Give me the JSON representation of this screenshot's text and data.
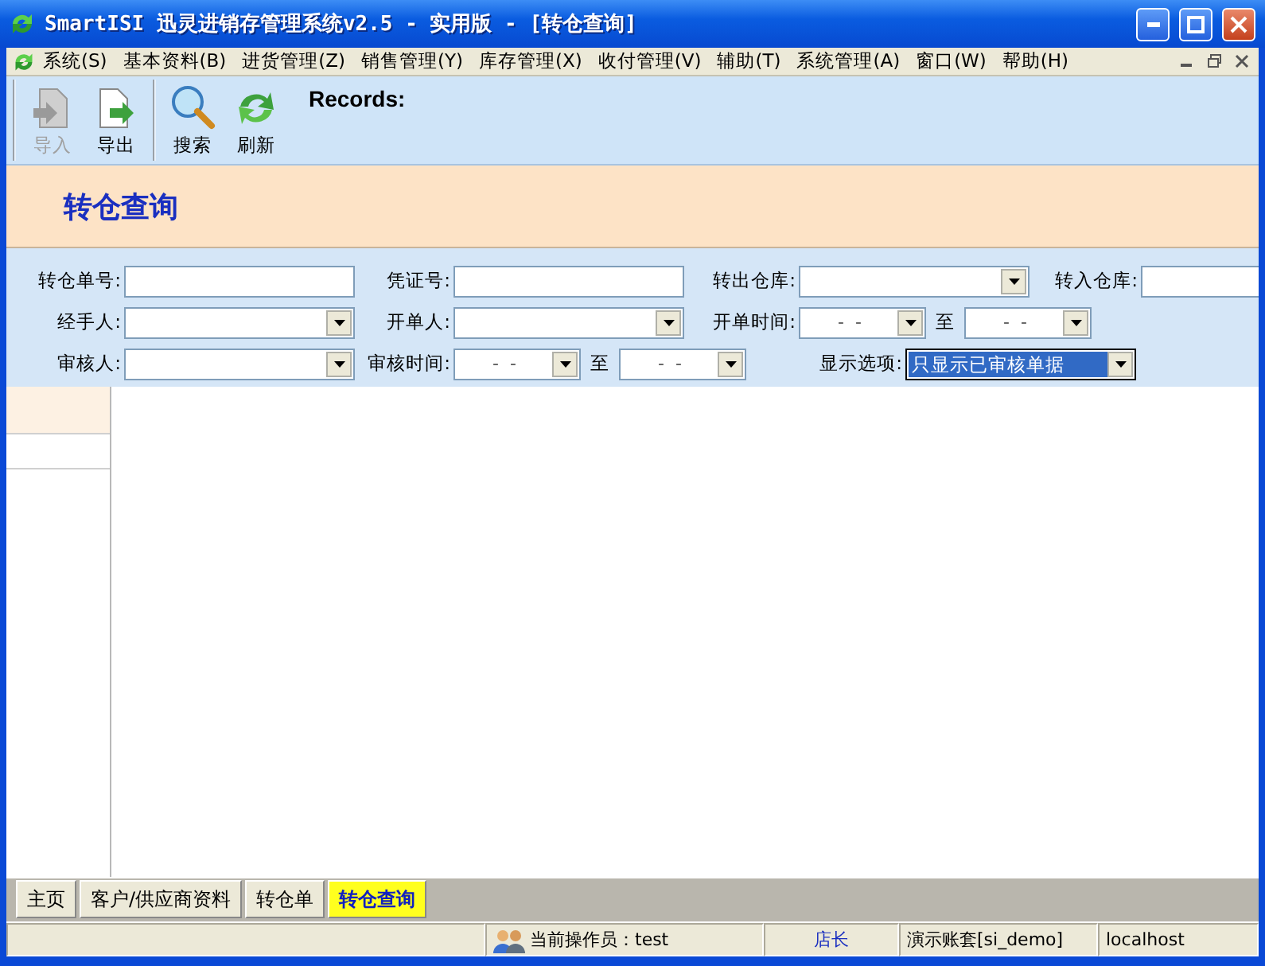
{
  "window": {
    "title": "SmartISI 迅灵进销存管理系统v2.5 - 实用版 - [转仓查询]"
  },
  "menu": [
    "系统(S)",
    "基本资料(B)",
    "进货管理(Z)",
    "销售管理(Y)",
    "库存管理(X)",
    "收付管理(V)",
    "辅助(T)",
    "系统管理(A)",
    "窗口(W)",
    "帮助(H)"
  ],
  "toolbar": {
    "groups": [
      [
        {
          "kind": "import",
          "label": "导入",
          "disabled": true
        },
        {
          "kind": "export",
          "label": "导出",
          "disabled": false
        }
      ],
      [
        {
          "kind": "search",
          "label": "搜索",
          "disabled": false
        },
        {
          "kind": "refresh",
          "label": "刷新",
          "disabled": false
        }
      ]
    ],
    "records_label": "Records:"
  },
  "page_title": "转仓查询",
  "filters": [
    [
      {
        "kind": "text",
        "label": "转仓单号:"
      },
      {
        "kind": "text",
        "label": "凭证号:"
      },
      {
        "kind": "combo",
        "label": "转出仓库:"
      },
      {
        "kind": "text",
        "label": "转入仓库:"
      }
    ],
    [
      {
        "kind": "combo",
        "label": "经手人:"
      },
      {
        "kind": "combo",
        "label": "开单人:"
      },
      {
        "kind": "range",
        "label": "开单时间:",
        "from": "-  -",
        "sep": "至",
        "to": "-  -"
      }
    ],
    [
      {
        "kind": "combo",
        "label": "审核人:"
      },
      {
        "kind": "range",
        "label": "审核时间:",
        "from": "-  -",
        "sep": "至",
        "to": "-  -"
      },
      {
        "kind": "combo",
        "label": "显示选项:",
        "value": "只显示已审核单据",
        "highlighted": true
      }
    ]
  ],
  "tabs": [
    {
      "label": "主页",
      "selected": false
    },
    {
      "label": "客户/供应商资料",
      "selected": false
    },
    {
      "label": "转仓单",
      "selected": false
    },
    {
      "label": "转仓查询",
      "selected": true
    }
  ],
  "status_bar": {
    "operator": "当前操作员：test",
    "role": "店长",
    "account": "演示账套[si_demo]",
    "host": "localhost"
  }
}
